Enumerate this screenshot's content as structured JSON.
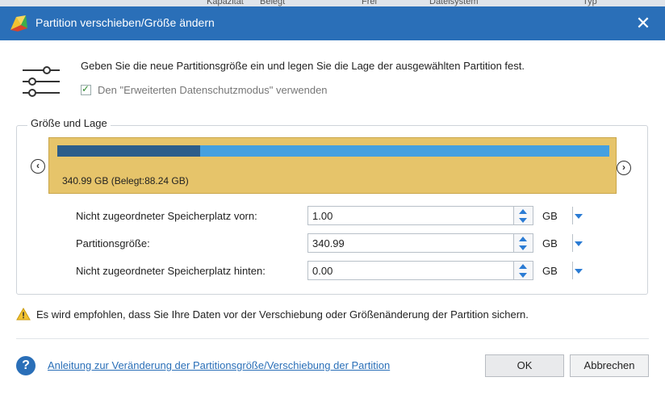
{
  "background_headers": [
    "Kapazität",
    "Belegt",
    "Frei",
    "Dateisystem",
    "Typ"
  ],
  "dialog": {
    "title": "Partition verschieben/Größe ändern",
    "description": "Geben Sie die neue Partitionsgröße ein und legen Sie die Lage der ausgewählten Partition fest.",
    "protection_checkbox": {
      "label": "Den \"Erweiterten Datenschutzmodus\" verwenden",
      "checked": true
    },
    "group_label": "Größe und Lage",
    "partition": {
      "label": "340.99 GB (Belegt:88.24 GB)",
      "used_fraction": 0.2588
    },
    "fields": [
      {
        "label": "Nicht zugeordneter Speicherplatz vorn:",
        "value": "1.00",
        "unit": "GB"
      },
      {
        "label": "Partitionsgröße:",
        "value": "340.99",
        "unit": "GB"
      },
      {
        "label": "Nicht zugeordneter Speicherplatz hinten:",
        "value": "0.00",
        "unit": "GB"
      }
    ],
    "warning": "Es wird empfohlen, dass Sie Ihre Daten vor der Verschiebung oder Größenänderung der Partition sichern.",
    "help_link": "Anleitung zur Veränderung der Partitionsgröße/Verschiebung der Partition",
    "ok_label": "OK",
    "cancel_label": "Abbrechen"
  },
  "colors": {
    "titlebar": "#2a6fb8",
    "partition_fill": "#e6c46a",
    "bar_free": "#45a0e0",
    "bar_used": "#2c5d8a"
  }
}
